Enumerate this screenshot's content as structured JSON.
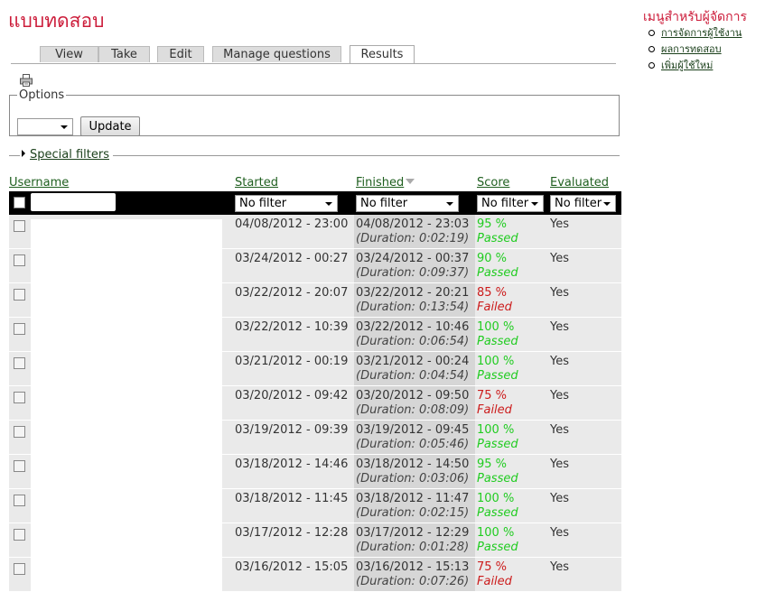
{
  "page": {
    "title": "แบบทดสอบ"
  },
  "tabs": [
    {
      "label": "View"
    },
    {
      "label": "Take"
    },
    {
      "label": "Edit"
    },
    {
      "label": "Manage questions"
    },
    {
      "label": "Results",
      "active": true
    }
  ],
  "options": {
    "legend": "Options",
    "select_value": "",
    "update_label": "Update"
  },
  "special_filters": {
    "label": "Special filters"
  },
  "table": {
    "headers": {
      "username": "Username",
      "started": "Started",
      "finished": "Finished",
      "score": "Score",
      "evaluated": "Evaluated"
    },
    "filters": {
      "started": "No filter",
      "finished": "No filter",
      "score": "No filter",
      "evaluated": "No filter"
    },
    "rows": [
      {
        "started": "04/08/2012 - 23:00",
        "finished": "04/08/2012 - 23:03",
        "duration": "(Duration: 0:02:19)",
        "score": "95 %",
        "status": "Passed",
        "evaluated": "Yes"
      },
      {
        "started": "03/24/2012 - 00:27",
        "finished": "03/24/2012 - 00:37",
        "duration": "(Duration: 0:09:37)",
        "score": "90 %",
        "status": "Passed",
        "evaluated": "Yes"
      },
      {
        "started": "03/22/2012 - 20:07",
        "finished": "03/22/2012 - 20:21",
        "duration": "(Duration: 0:13:54)",
        "score": "85 %",
        "status": "Failed",
        "evaluated": "Yes"
      },
      {
        "started": "03/22/2012 - 10:39",
        "finished": "03/22/2012 - 10:46",
        "duration": "(Duration: 0:06:54)",
        "score": "100 %",
        "status": "Passed",
        "evaluated": "Yes"
      },
      {
        "started": "03/21/2012 - 00:19",
        "finished": "03/21/2012 - 00:24",
        "duration": "(Duration: 0:04:54)",
        "score": "100 %",
        "status": "Passed",
        "evaluated": "Yes"
      },
      {
        "started": "03/20/2012 - 09:42",
        "finished": "03/20/2012 - 09:50",
        "duration": "(Duration: 0:08:09)",
        "score": "75 %",
        "status": "Failed",
        "evaluated": "Yes"
      },
      {
        "started": "03/19/2012 - 09:39",
        "finished": "03/19/2012 - 09:45",
        "duration": "(Duration: 0:05:46)",
        "score": "100 %",
        "status": "Passed",
        "evaluated": "Yes"
      },
      {
        "started": "03/18/2012 - 14:46",
        "finished": "03/18/2012 - 14:50",
        "duration": "(Duration: 0:03:06)",
        "score": "95 %",
        "status": "Passed",
        "evaluated": "Yes"
      },
      {
        "started": "03/18/2012 - 11:45",
        "finished": "03/18/2012 - 11:47",
        "duration": "(Duration: 0:02:15)",
        "score": "100 %",
        "status": "Passed",
        "evaluated": "Yes"
      },
      {
        "started": "03/17/2012 - 12:28",
        "finished": "03/17/2012 - 12:29",
        "duration": "(Duration: 0:01:28)",
        "score": "100 %",
        "status": "Passed",
        "evaluated": "Yes"
      },
      {
        "started": "03/16/2012 - 15:05",
        "finished": "03/16/2012 - 15:13",
        "duration": "(Duration: 0:07:26)",
        "score": "75 %",
        "status": "Failed",
        "evaluated": "Yes"
      }
    ]
  },
  "admin_menu": {
    "title": "เมนูสำหรับผู้จัดการ",
    "items": [
      {
        "label": "การจัดการผู้ใช้งาน"
      },
      {
        "label": "ผลการทดสอบ"
      },
      {
        "label": "เพิ่มผู้ใช้ใหม่"
      }
    ]
  },
  "colors": {
    "title": "#cc1c3a",
    "pass": "#22cc22",
    "fail": "#cc1c1c",
    "link": "#1f5f1f"
  },
  "icons": {
    "print": "printer-icon",
    "expand": "triangle-right-icon",
    "sort": "sort-desc-icon"
  }
}
